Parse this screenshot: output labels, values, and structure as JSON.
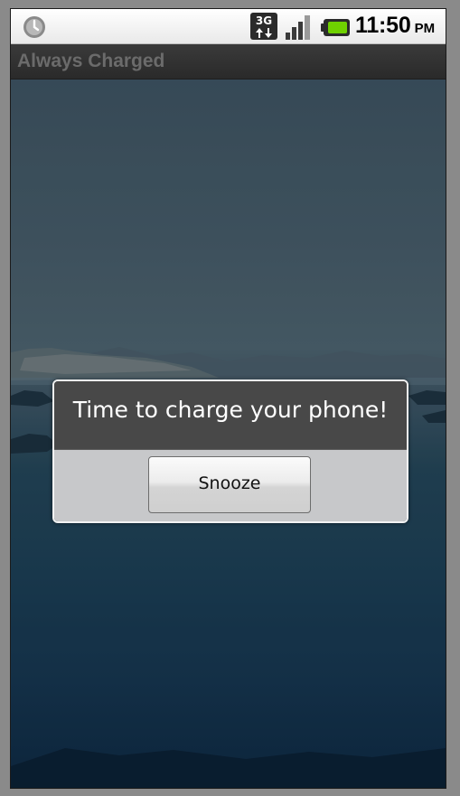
{
  "status_bar": {
    "time": "11:50",
    "ampm": "PM",
    "network_label": "3G",
    "icons": [
      "alarm-icon",
      "network-3g-icon",
      "signal-icon",
      "battery-icon"
    ],
    "battery_color": "#6fd100"
  },
  "app": {
    "title": "Always Charged"
  },
  "dialog": {
    "message": "Time to charge your phone!",
    "snooze_label": "Snooze"
  },
  "colors": {
    "title_bar": "#2f2f2f",
    "title_text": "#6b6b6b",
    "dialog_body": "#484848",
    "dialog_button_area": "#c7c8ca"
  }
}
